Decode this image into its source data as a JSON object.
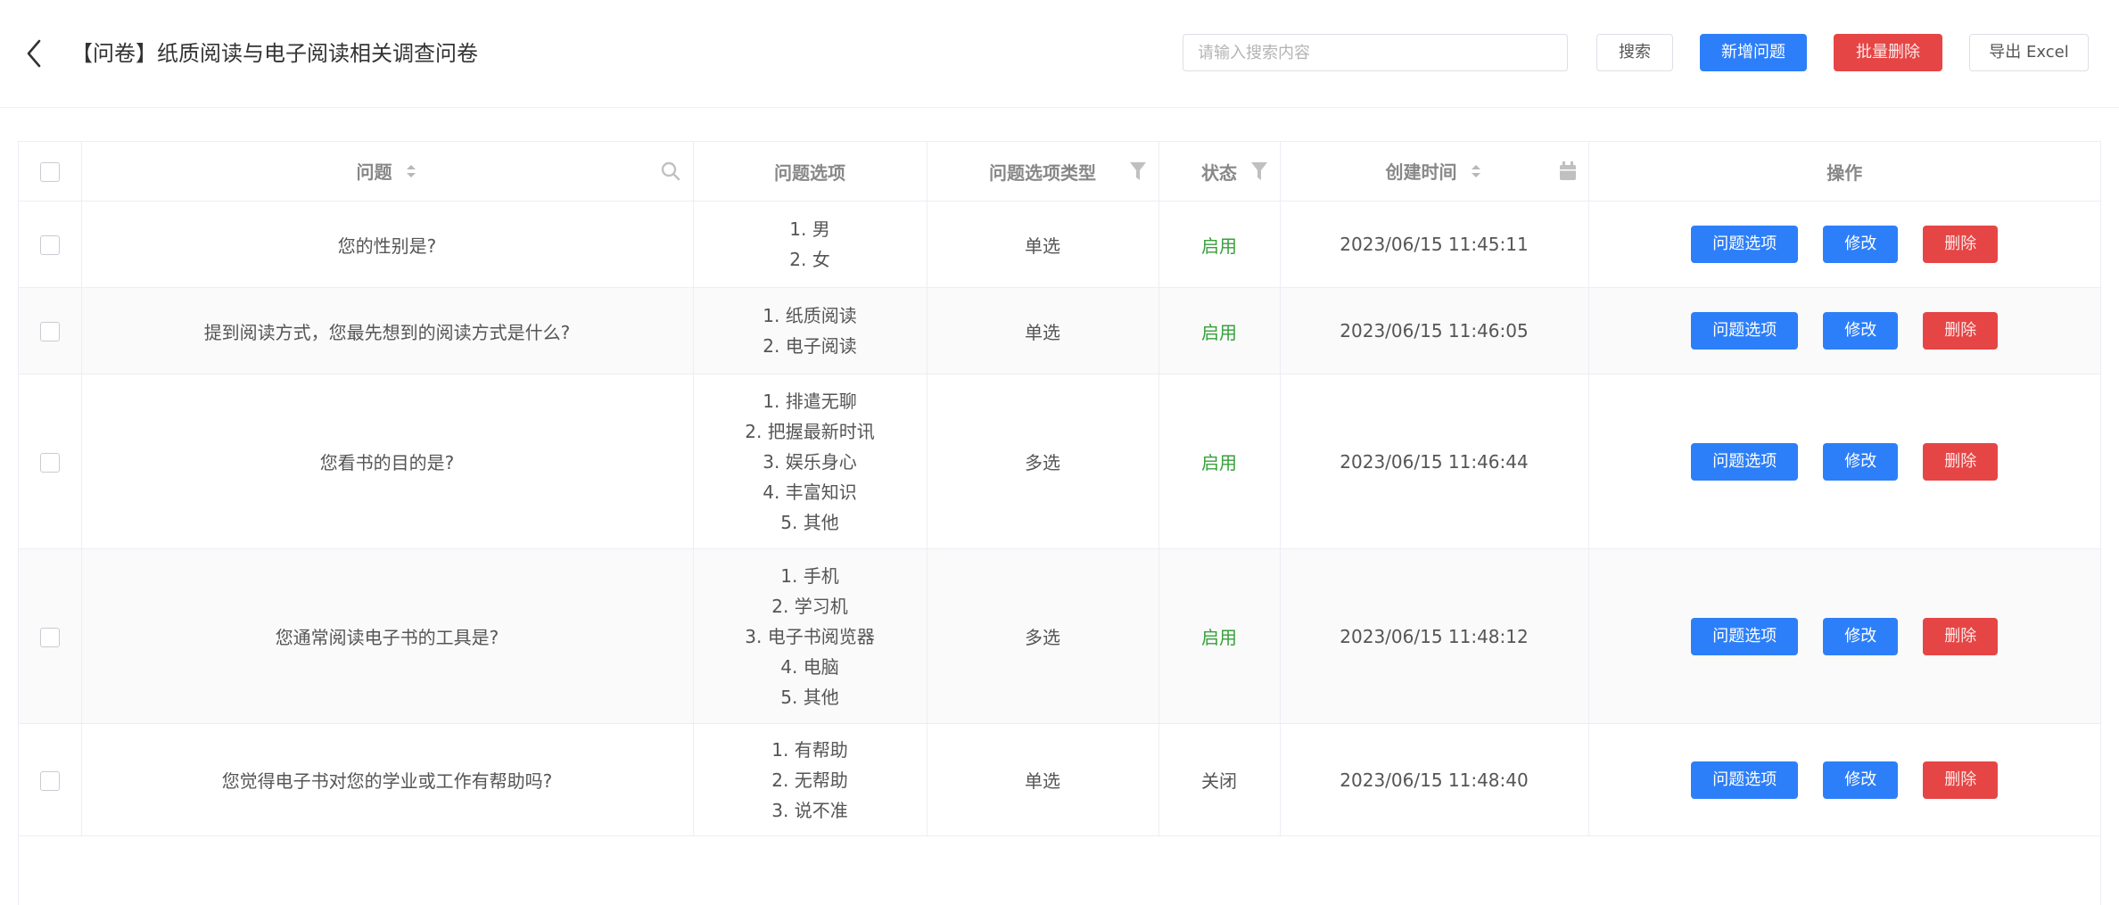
{
  "header": {
    "title": "【问卷】纸质阅读与电子阅读相关调查问卷",
    "search_placeholder": "请输入搜索内容",
    "search_label": "搜索",
    "add_label": "新增问题",
    "batch_delete_label": "批量删除",
    "export_label": "导出 Excel"
  },
  "table": {
    "columns": [
      "问题",
      "问题选项",
      "问题选项类型",
      "状态",
      "创建时间",
      "操作"
    ],
    "actions": {
      "options": "问题选项",
      "edit": "修改",
      "delete": "删除"
    },
    "rows": [
      {
        "question": "您的性别是?",
        "options": [
          "1. 男",
          "2. 女"
        ],
        "type": "单选",
        "status": "启用",
        "status_on": true,
        "created": "2023/06/15 11:45:11"
      },
      {
        "question": "提到阅读方式，您最先想到的阅读方式是什么?",
        "options": [
          "1. 纸质阅读",
          "2. 电子阅读"
        ],
        "type": "单选",
        "status": "启用",
        "status_on": true,
        "created": "2023/06/15 11:46:05"
      },
      {
        "question": "您看书的目的是?",
        "options": [
          "1. 排遣无聊",
          "2. 把握最新时讯",
          "3. 娱乐身心",
          "4. 丰富知识",
          "5. 其他"
        ],
        "type": "多选",
        "status": "启用",
        "status_on": true,
        "created": "2023/06/15 11:46:44"
      },
      {
        "question": "您通常阅读电子书的工具是?",
        "options": [
          "1. 手机",
          "2. 学习机",
          "3. 电子书阅览器",
          "4. 电脑",
          "5. 其他"
        ],
        "type": "多选",
        "status": "启用",
        "status_on": true,
        "created": "2023/06/15 11:48:12"
      },
      {
        "question": "您觉得电子书对您的学业或工作有帮助吗?",
        "options": [
          "1. 有帮助",
          "2. 无帮助",
          "3. 说不准"
        ],
        "type": "单选",
        "status": "关闭",
        "status_on": false,
        "created": "2023/06/15 11:48:40"
      }
    ]
  },
  "colors": {
    "primary": "#2d7ff9",
    "danger": "#e64545",
    "status_on": "#37a03b"
  },
  "icons": {
    "back": "chevron-left-icon",
    "sort": "sort-icon",
    "search": "search-icon",
    "filter": "filter-icon",
    "calendar": "calendar-icon"
  }
}
